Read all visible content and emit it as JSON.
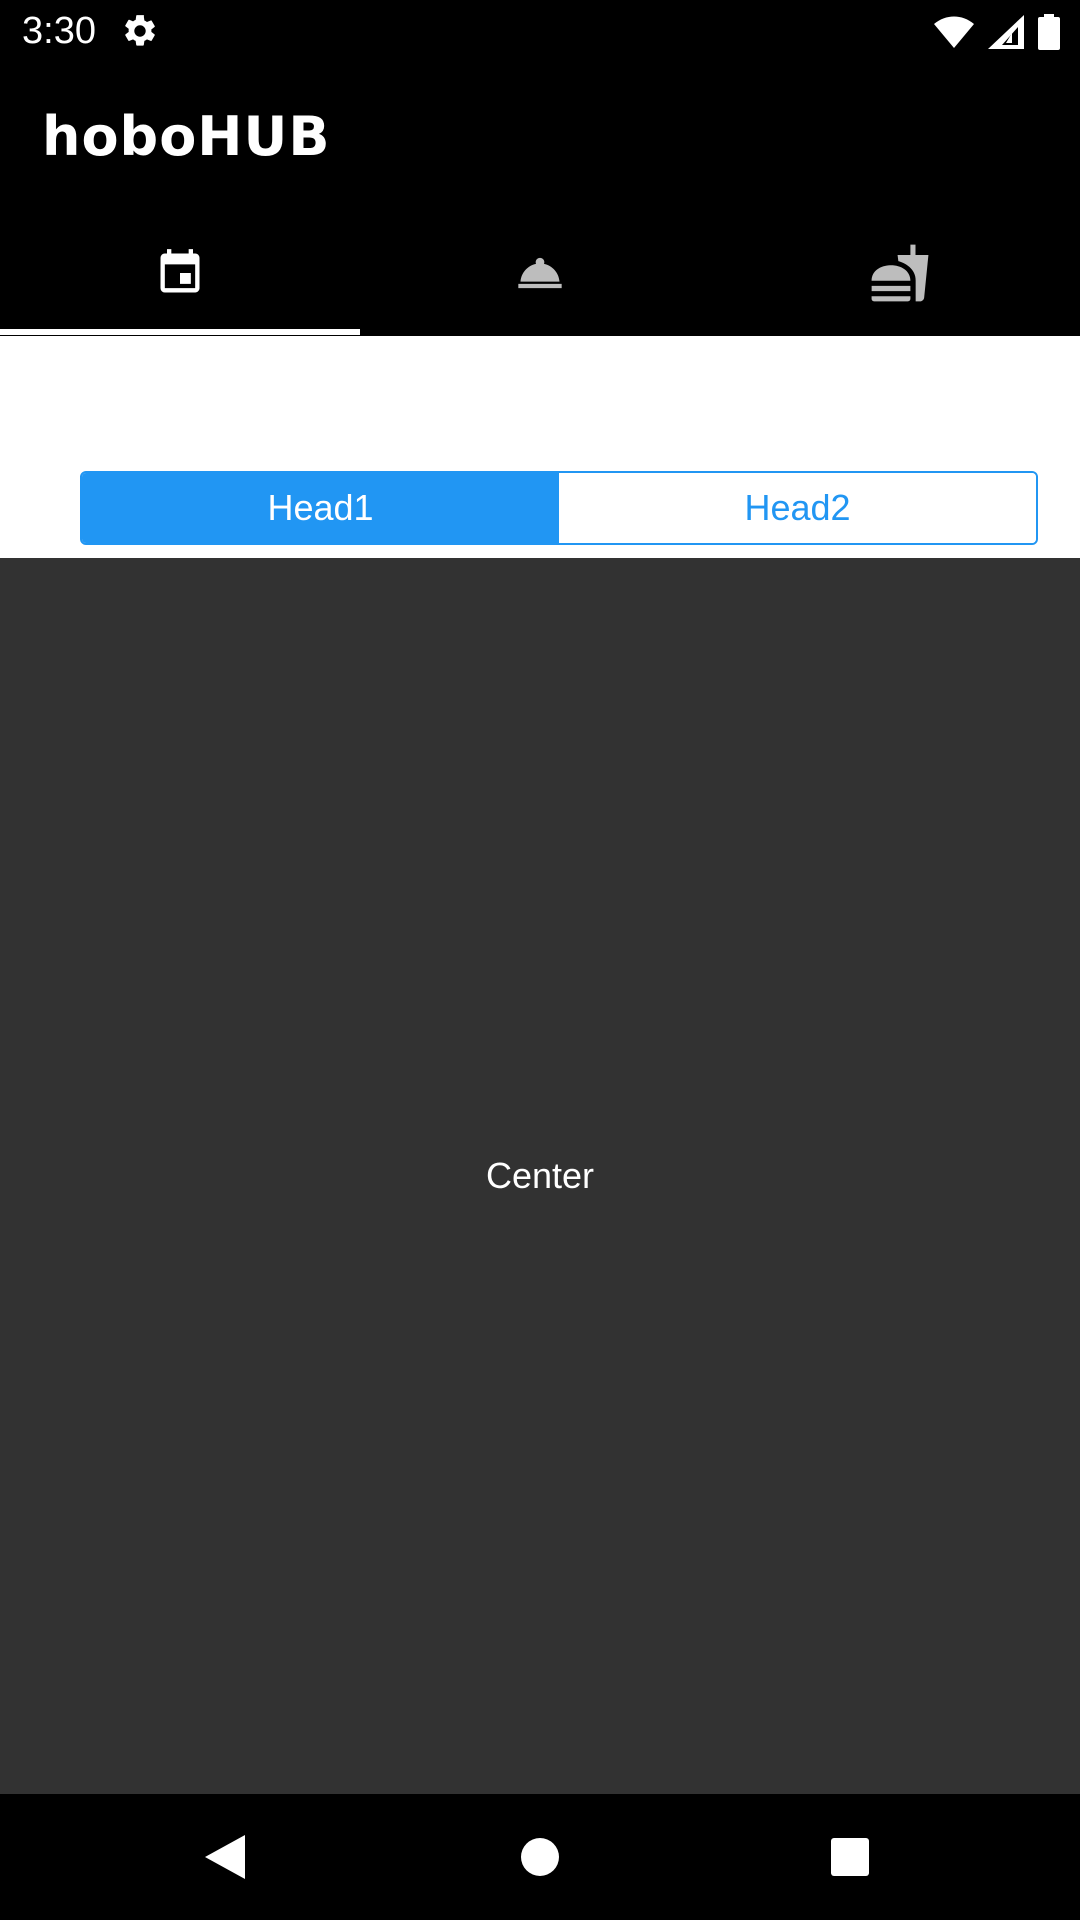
{
  "status_bar": {
    "time": "3:30",
    "icons": [
      "settings-gear-icon",
      "wifi-icon",
      "cell-signal-icon",
      "battery-icon"
    ]
  },
  "app_bar": {
    "title": "hoboHUB",
    "tabs": [
      {
        "icon": "calendar-icon",
        "selected": true
      },
      {
        "icon": "room-service-bell-icon",
        "selected": false
      },
      {
        "icon": "fastfood-icon",
        "selected": false
      }
    ]
  },
  "segmented_control": {
    "options": [
      "Head1",
      "Head2"
    ],
    "selected": "Head1"
  },
  "main": {
    "center_text": "Center"
  },
  "nav_bar": {
    "buttons": [
      "back-icon",
      "home-icon",
      "recents-icon"
    ]
  },
  "colors": {
    "accent": "#2196F3",
    "content_bg": "#323232",
    "bar_bg": "#000000"
  }
}
